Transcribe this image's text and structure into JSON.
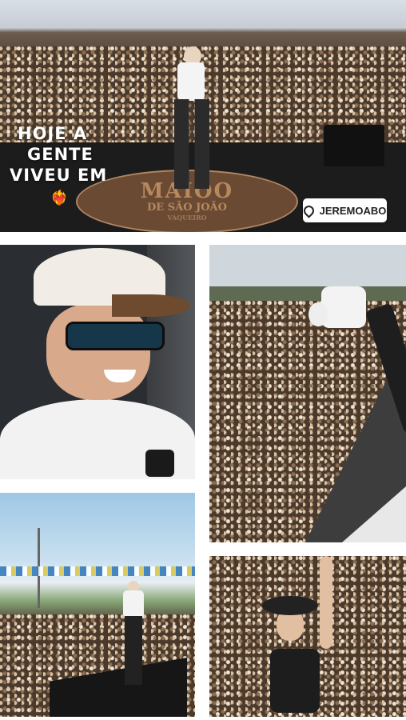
{
  "hero": {
    "title_lines": [
      "HOJE A",
      "GENTE",
      "VIVEU EM"
    ],
    "heart_emoji": "❤️‍🔥",
    "location": {
      "icon": "location-pin-icon",
      "label": "JEREMOABO"
    },
    "stage_logo": {
      "line1": "MAIOO",
      "line2": "DE SÃO JOÃO",
      "line3": "VAQUEIRO"
    }
  },
  "colors": {
    "background": "#ffffff",
    "pill_background": "#ffffff",
    "pill_text": "#222222",
    "title_text": "#ffffff"
  }
}
